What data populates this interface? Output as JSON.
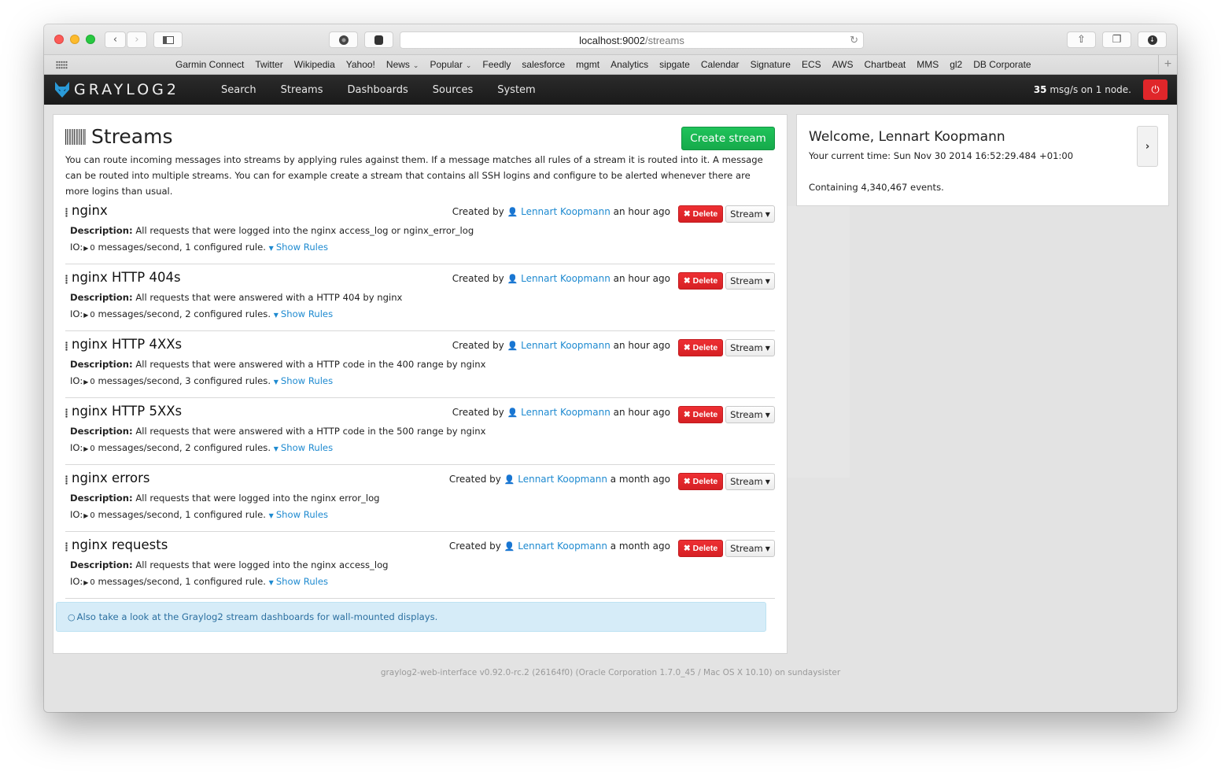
{
  "browser": {
    "url_host": "localhost:9002",
    "url_path": "/streams",
    "bookmarks": [
      {
        "label": "Garmin Connect"
      },
      {
        "label": "Twitter"
      },
      {
        "label": "Wikipedia"
      },
      {
        "label": "Yahoo!"
      },
      {
        "label": "News",
        "dropdown": true
      },
      {
        "label": "Popular",
        "dropdown": true
      },
      {
        "label": "Feedly"
      },
      {
        "label": "salesforce"
      },
      {
        "label": "mgmt"
      },
      {
        "label": "Analytics"
      },
      {
        "label": "sipgate"
      },
      {
        "label": "Calendar"
      },
      {
        "label": "Signature"
      },
      {
        "label": "ECS"
      },
      {
        "label": "AWS"
      },
      {
        "label": "Chartbeat"
      },
      {
        "label": "MMS"
      },
      {
        "label": "gl2"
      },
      {
        "label": "DB Corporate"
      }
    ]
  },
  "navbar": {
    "brand": "GRAYLOG2",
    "links": [
      "Search",
      "Streams",
      "Dashboards",
      "Sources",
      "System"
    ],
    "throughput_count": "35",
    "throughput_text": " msg/s on 1 node."
  },
  "page": {
    "title": "Streams",
    "create_button": "Create stream",
    "intro": "You can route incoming messages into streams by applying rules against them. If a message matches all rules of a stream it is routed into it. A message can be routed into multiple streams. You can for example create a stream that contains all SSH logins and configure to be alerted whenever there are more logins than usual."
  },
  "labels": {
    "description": "Description:",
    "io": "IO:",
    "created_by": "Created by ",
    "show_rules": "Show Rules",
    "delete": "Delete",
    "stream_menu": "Stream"
  },
  "streams": [
    {
      "title": "nginx",
      "description": "All requests that were logged into the nginx access_log or nginx_error_log",
      "throughput": "0",
      "io_text": " messages/second, 1 configured rule.",
      "creator": "Lennart Koopmann",
      "created": " an hour ago"
    },
    {
      "title": "nginx HTTP 404s",
      "description": "All requests that were answered with a HTTP 404 by nginx",
      "throughput": "0",
      "io_text": " messages/second, 2 configured rules.",
      "creator": "Lennart Koopmann",
      "created": " an hour ago"
    },
    {
      "title": "nginx HTTP 4XXs",
      "description": "All requests that were answered with a HTTP code in the 400 range by nginx",
      "throughput": "0",
      "io_text": " messages/second, 3 configured rules.",
      "creator": "Lennart Koopmann",
      "created": " an hour ago"
    },
    {
      "title": "nginx HTTP 5XXs",
      "description": "All requests that were answered with a HTTP code in the 500 range by nginx",
      "throughput": "0",
      "io_text": " messages/second, 2 configured rules.",
      "creator": "Lennart Koopmann",
      "created": " an hour ago"
    },
    {
      "title": "nginx errors",
      "description": "All requests that were logged into the nginx error_log",
      "throughput": "0",
      "io_text": " messages/second, 1 configured rule.",
      "creator": "Lennart Koopmann",
      "created": " a month ago"
    },
    {
      "title": "nginx requests",
      "description": "All requests that were logged into the nginx access_log",
      "throughput": "0",
      "io_text": " messages/second, 1 configured rule.",
      "creator": "Lennart Koopmann",
      "created": " a month ago"
    }
  ],
  "info_box": "Also take a look at the Graylog2 stream dashboards for wall-mounted displays.",
  "welcome": {
    "title": "Welcome, Lennart Koopmann",
    "time": "Your current time: Sun Nov 30 2014 16:52:29.484 +01:00",
    "events": "Containing 4,340,467 events."
  },
  "footer": "graylog2-web-interface v0.92.0-rc.2 (26164f0) (Oracle Corporation 1.7.0_45 / Mac OS X 10.10) on sundaysister",
  "colors": {
    "brand_blue": "#1e8ad0",
    "create_green": "#1fc35a",
    "delete_red": "#e0262a",
    "info_bg": "#d6ecf8"
  }
}
